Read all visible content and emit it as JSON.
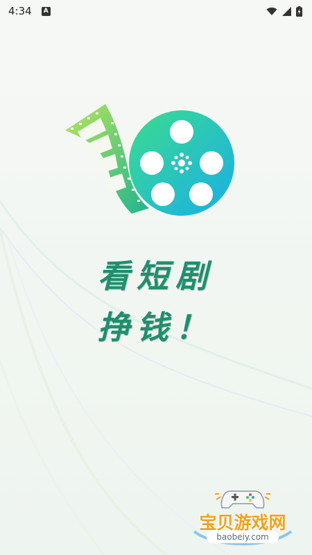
{
  "status_bar": {
    "time": "4:34",
    "left_icon": "A",
    "icons": [
      "wifi-icon",
      "signal-icon",
      "battery-icon"
    ]
  },
  "slogan": {
    "line1": "看短剧",
    "line2": "挣钱！"
  },
  "watermark": {
    "title": "宝贝游戏网",
    "url": "baobeiy.com"
  },
  "colors": {
    "accent": "#1f8f6e",
    "reel_gradient_start": "#33d6a0",
    "reel_gradient_end": "#1bb0e8",
    "film_gradient_start": "#a7e05a",
    "film_gradient_end": "#1fb58f",
    "watermark": "#f0a21c"
  }
}
